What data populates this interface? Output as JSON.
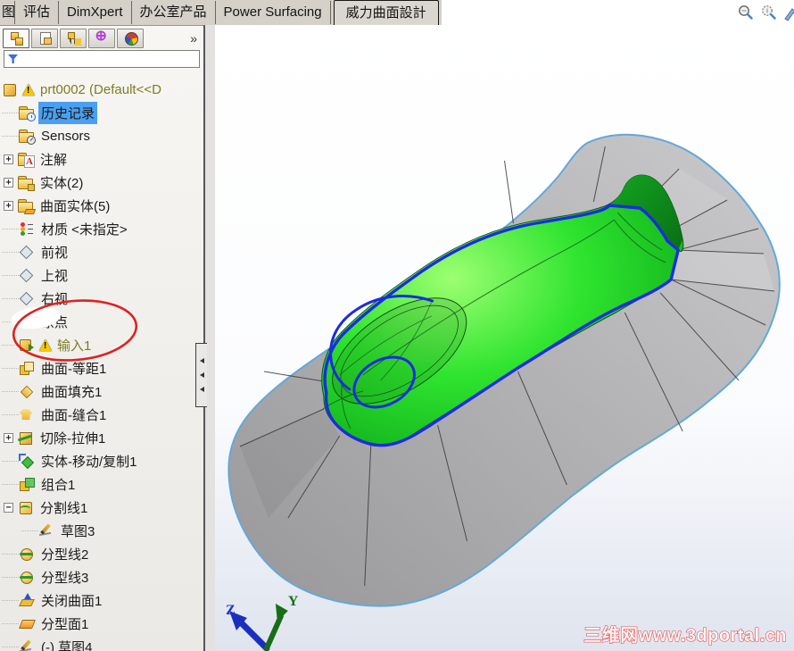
{
  "ribbon": {
    "tabs": [
      {
        "label": "图",
        "state": "partial"
      },
      {
        "label": "评估",
        "state": "normal"
      },
      {
        "label": "DimXpert",
        "state": "normal"
      },
      {
        "label": "办公室产品",
        "state": "normal"
      },
      {
        "label": "Power Surfacing",
        "state": "normal"
      },
      {
        "label": "威力曲面設計",
        "state": "active"
      }
    ],
    "right_icons": [
      "zoom-to-fit",
      "zoom-to-area",
      "pen-partial"
    ]
  },
  "panel": {
    "manager_tabs": [
      {
        "name": "featuremanager-design-tree",
        "active": true
      },
      {
        "name": "propertymanager",
        "active": false
      },
      {
        "name": "configurationmanager",
        "active": false
      },
      {
        "name": "dimxpertmanager",
        "active": false
      },
      {
        "name": "displaymanager",
        "active": false
      }
    ],
    "overflow_chevron": "»",
    "filter_value": "",
    "tree": [
      {
        "label": "prt0002  (Default<<D",
        "icon": "part",
        "level": 0,
        "warning": true,
        "olive": true
      },
      {
        "label": "历史记录",
        "icon": "history-folder",
        "level": 1,
        "selected": true
      },
      {
        "label": "Sensors",
        "icon": "sensors-folder",
        "level": 1
      },
      {
        "label": "注解",
        "icon": "annotations-folder",
        "level": 1,
        "expand": "+"
      },
      {
        "label": "实体(2)",
        "icon": "solid-bodies-folder",
        "level": 1,
        "expand": "+"
      },
      {
        "label": "曲面实体(5)",
        "icon": "surface-bodies-folder",
        "level": 1,
        "expand": "+"
      },
      {
        "label": "材质 <未指定>",
        "icon": "material",
        "level": 1
      },
      {
        "label": "前视",
        "icon": "plane",
        "level": 1
      },
      {
        "label": "上视",
        "icon": "plane",
        "level": 1
      },
      {
        "label": "右视",
        "icon": "plane",
        "level": 1
      },
      {
        "label": "原点",
        "icon": "origin",
        "level": 1,
        "obscured": true
      },
      {
        "label": "输入1",
        "icon": "imported-feature",
        "level": 1,
        "warning": true,
        "olive": true,
        "circled": true
      },
      {
        "label": "曲面-等距1",
        "icon": "surface-offset",
        "level": 1
      },
      {
        "label": "曲面填充1",
        "icon": "surface-fill",
        "level": 1
      },
      {
        "label": "曲面-缝合1",
        "icon": "surface-knit",
        "level": 1
      },
      {
        "label": "切除-拉伸1",
        "icon": "cut-extrude",
        "level": 1,
        "expand": "+"
      },
      {
        "label": "实体-移动/复制1",
        "icon": "move-copy-body",
        "level": 1
      },
      {
        "label": "组合1",
        "icon": "combine",
        "level": 1
      },
      {
        "label": "分割线1",
        "icon": "split-line",
        "level": 1,
        "expand": "−"
      },
      {
        "label": "草图3",
        "icon": "sketch",
        "level": 2
      },
      {
        "label": "分型线2",
        "icon": "parting-line",
        "level": 1
      },
      {
        "label": "分型线3",
        "icon": "parting-line",
        "level": 1
      },
      {
        "label": "关闭曲面1",
        "icon": "shutoff-surface",
        "level": 1
      },
      {
        "label": "分型面1",
        "icon": "parting-surface",
        "level": 1
      },
      {
        "label": "(-) 草图4",
        "icon": "sketch",
        "level": 1
      }
    ]
  },
  "viewport": {
    "watermark": "三维网www.3dportal.cn",
    "triad": {
      "z": "Z",
      "y": "Y"
    },
    "colors": {
      "model_green": "#1ecb1e",
      "parting_line_blue": "#1c2ce0",
      "surface_gray": "#ababad",
      "surface_edge_blue": "#63a8da",
      "annotation_red": "#dd2222",
      "selection_blue": "#49a0f2"
    }
  }
}
